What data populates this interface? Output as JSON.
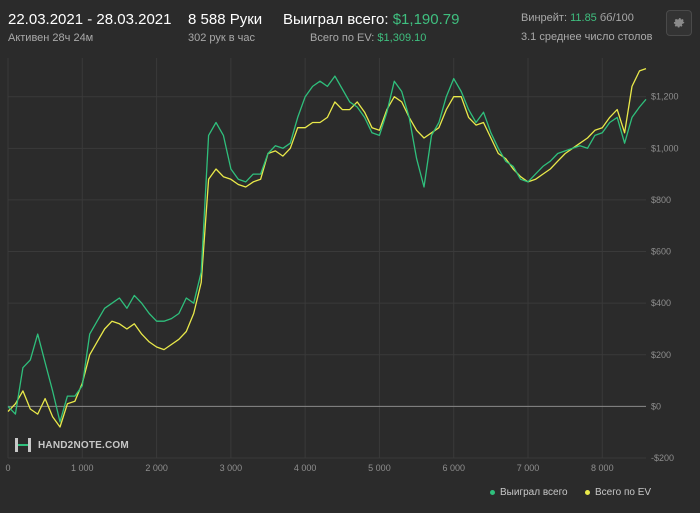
{
  "header": {
    "date_range": "22.03.2021 - 28.03.2021",
    "active_time": "Активен 28ч 24м",
    "hands": "8 588 Руки",
    "hands_per_hour": "302 рук в час",
    "won_label": "Выиграл всего:",
    "won_value": "$1,190.79",
    "ev_label": "Всего по EV:",
    "ev_value": "$1,309.10",
    "winrate_label": "Винрейт:",
    "winrate_value": "11.85",
    "winrate_unit": "бб/100",
    "avg_tables": "3.1 среднее число столов"
  },
  "settings_icon": "gear-icon",
  "logo": {
    "text": "HAND2NOTE.COM",
    "icon": "h2n-logo-icon"
  },
  "colors": {
    "background": "#2b2b2b",
    "won_line": "#2fbf7c",
    "ev_line": "#e9e94a",
    "accent_green": "#3fbf7f"
  },
  "chart_data": {
    "type": "line",
    "xlim": [
      0,
      8588
    ],
    "ylim": [
      -200,
      1350
    ],
    "x_ticks": [
      "0",
      "1 000",
      "2 000",
      "3 000",
      "4 000",
      "5 000",
      "6 000",
      "7 000",
      "8 000"
    ],
    "x_tick_values": [
      0,
      1000,
      2000,
      3000,
      4000,
      5000,
      6000,
      7000,
      8000
    ],
    "y_ticks": [
      "-$200",
      "$0",
      "$200",
      "$400",
      "$600",
      "$800",
      "$1,000",
      "$1,200"
    ],
    "y_tick_values": [
      -200,
      0,
      200,
      400,
      600,
      800,
      1000,
      1200
    ],
    "grid": true,
    "legend_position": "bottom-right",
    "series": [
      {
        "name": "Выиграл всего",
        "x": [
          0,
          100,
          200,
          300,
          400,
          500,
          600,
          700,
          800,
          900,
          1000,
          1100,
          1200,
          1300,
          1400,
          1500,
          1600,
          1700,
          1800,
          1900,
          2000,
          2100,
          2200,
          2300,
          2400,
          2500,
          2600,
          2700,
          2800,
          2900,
          3000,
          3100,
          3200,
          3300,
          3400,
          3500,
          3600,
          3700,
          3800,
          3900,
          4000,
          4100,
          4200,
          4300,
          4400,
          4500,
          4600,
          4700,
          4800,
          4900,
          5000,
          5100,
          5200,
          5300,
          5400,
          5500,
          5600,
          5700,
          5800,
          5900,
          6000,
          6100,
          6200,
          6300,
          6400,
          6500,
          6600,
          6700,
          6800,
          6900,
          7000,
          7100,
          7200,
          7300,
          7400,
          7500,
          7600,
          7700,
          7800,
          7900,
          8000,
          8100,
          8200,
          8300,
          8400,
          8500,
          8588
        ],
        "values": [
          0,
          -30,
          150,
          180,
          280,
          170,
          60,
          -60,
          40,
          40,
          80,
          280,
          330,
          380,
          400,
          420,
          380,
          430,
          400,
          360,
          330,
          330,
          340,
          360,
          420,
          400,
          520,
          1050,
          1100,
          1050,
          920,
          880,
          870,
          900,
          900,
          980,
          1010,
          1000,
          1020,
          1120,
          1200,
          1240,
          1260,
          1240,
          1280,
          1230,
          1180,
          1160,
          1120,
          1060,
          1050,
          1140,
          1260,
          1220,
          1120,
          960,
          850,
          1050,
          1100,
          1200,
          1270,
          1220,
          1150,
          1100,
          1140,
          1060,
          1000,
          950,
          930,
          880,
          870,
          900,
          930,
          950,
          980,
          990,
          1000,
          1010,
          1000,
          1050,
          1060,
          1100,
          1120,
          1020,
          1120,
          1160,
          1190
        ]
      },
      {
        "name": "Всего по EV",
        "x": [
          0,
          100,
          200,
          300,
          400,
          500,
          600,
          700,
          800,
          900,
          1000,
          1100,
          1200,
          1300,
          1400,
          1500,
          1600,
          1700,
          1800,
          1900,
          2000,
          2100,
          2200,
          2300,
          2400,
          2500,
          2600,
          2700,
          2800,
          2900,
          3000,
          3100,
          3200,
          3300,
          3400,
          3500,
          3600,
          3700,
          3800,
          3900,
          4000,
          4100,
          4200,
          4300,
          4400,
          4500,
          4600,
          4700,
          4800,
          4900,
          5000,
          5100,
          5200,
          5300,
          5400,
          5500,
          5600,
          5700,
          5800,
          5900,
          6000,
          6100,
          6200,
          6300,
          6400,
          6500,
          6600,
          6700,
          6800,
          6900,
          7000,
          7100,
          7200,
          7300,
          7400,
          7500,
          7600,
          7700,
          7800,
          7900,
          8000,
          8100,
          8200,
          8300,
          8400,
          8500,
          8588
        ],
        "values": [
          -20,
          10,
          60,
          -10,
          -30,
          30,
          -40,
          -80,
          10,
          20,
          90,
          200,
          250,
          300,
          330,
          320,
          300,
          320,
          280,
          250,
          230,
          220,
          240,
          260,
          290,
          360,
          480,
          880,
          920,
          890,
          880,
          860,
          850,
          870,
          880,
          980,
          990,
          970,
          1000,
          1080,
          1080,
          1100,
          1100,
          1120,
          1180,
          1150,
          1150,
          1180,
          1140,
          1080,
          1070,
          1150,
          1200,
          1180,
          1120,
          1070,
          1040,
          1060,
          1080,
          1150,
          1200,
          1200,
          1120,
          1090,
          1100,
          1040,
          980,
          960,
          920,
          890,
          870,
          880,
          900,
          920,
          950,
          980,
          1000,
          1020,
          1040,
          1070,
          1080,
          1120,
          1150,
          1060,
          1240,
          1300,
          1309
        ]
      }
    ]
  },
  "legend": {
    "won": "Выиграл всего",
    "ev": "Всего по EV"
  }
}
